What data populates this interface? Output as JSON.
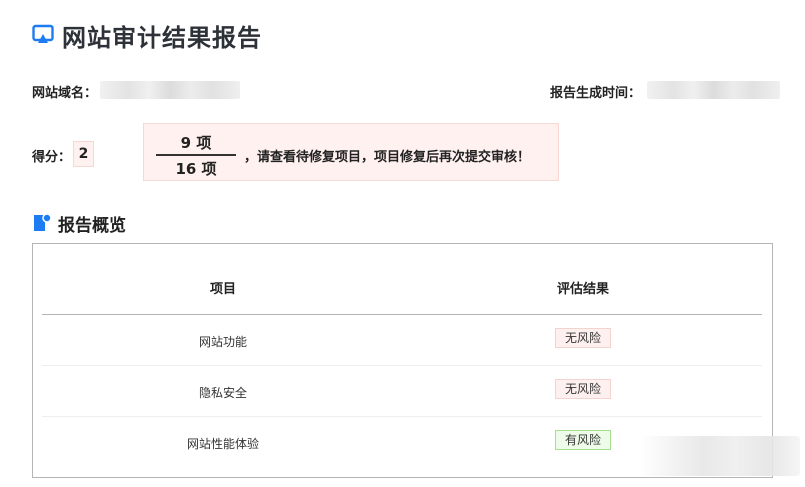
{
  "header": {
    "title": "网站审计结果报告",
    "icon": "monitor-icon",
    "accent": "#1e7cf2"
  },
  "info": {
    "domain_label": "网站域名：",
    "time_label": "报告生成时间："
  },
  "score": {
    "label": "得分：",
    "value": "2"
  },
  "summary": {
    "numerator": "9 项",
    "denominator": "16 项",
    "message": "，请查看待修复项目，项目修复后再次提交审核！"
  },
  "section": {
    "title": "报告概览",
    "icon": "report-flag-icon"
  },
  "table": {
    "headers": [
      "项目",
      "评估结果"
    ],
    "rows": [
      {
        "item": "网站功能",
        "result": "无风险",
        "status": "no-risk"
      },
      {
        "item": "隐私安全",
        "result": "无风险",
        "status": "no-risk"
      },
      {
        "item": "网站性能体验",
        "result": "有风险",
        "status": "risk"
      }
    ]
  },
  "colors": {
    "no_risk_bg": "#fdf0ee",
    "risk_bg": "#eefbe9",
    "highlight_bg": "#fff1ef"
  }
}
